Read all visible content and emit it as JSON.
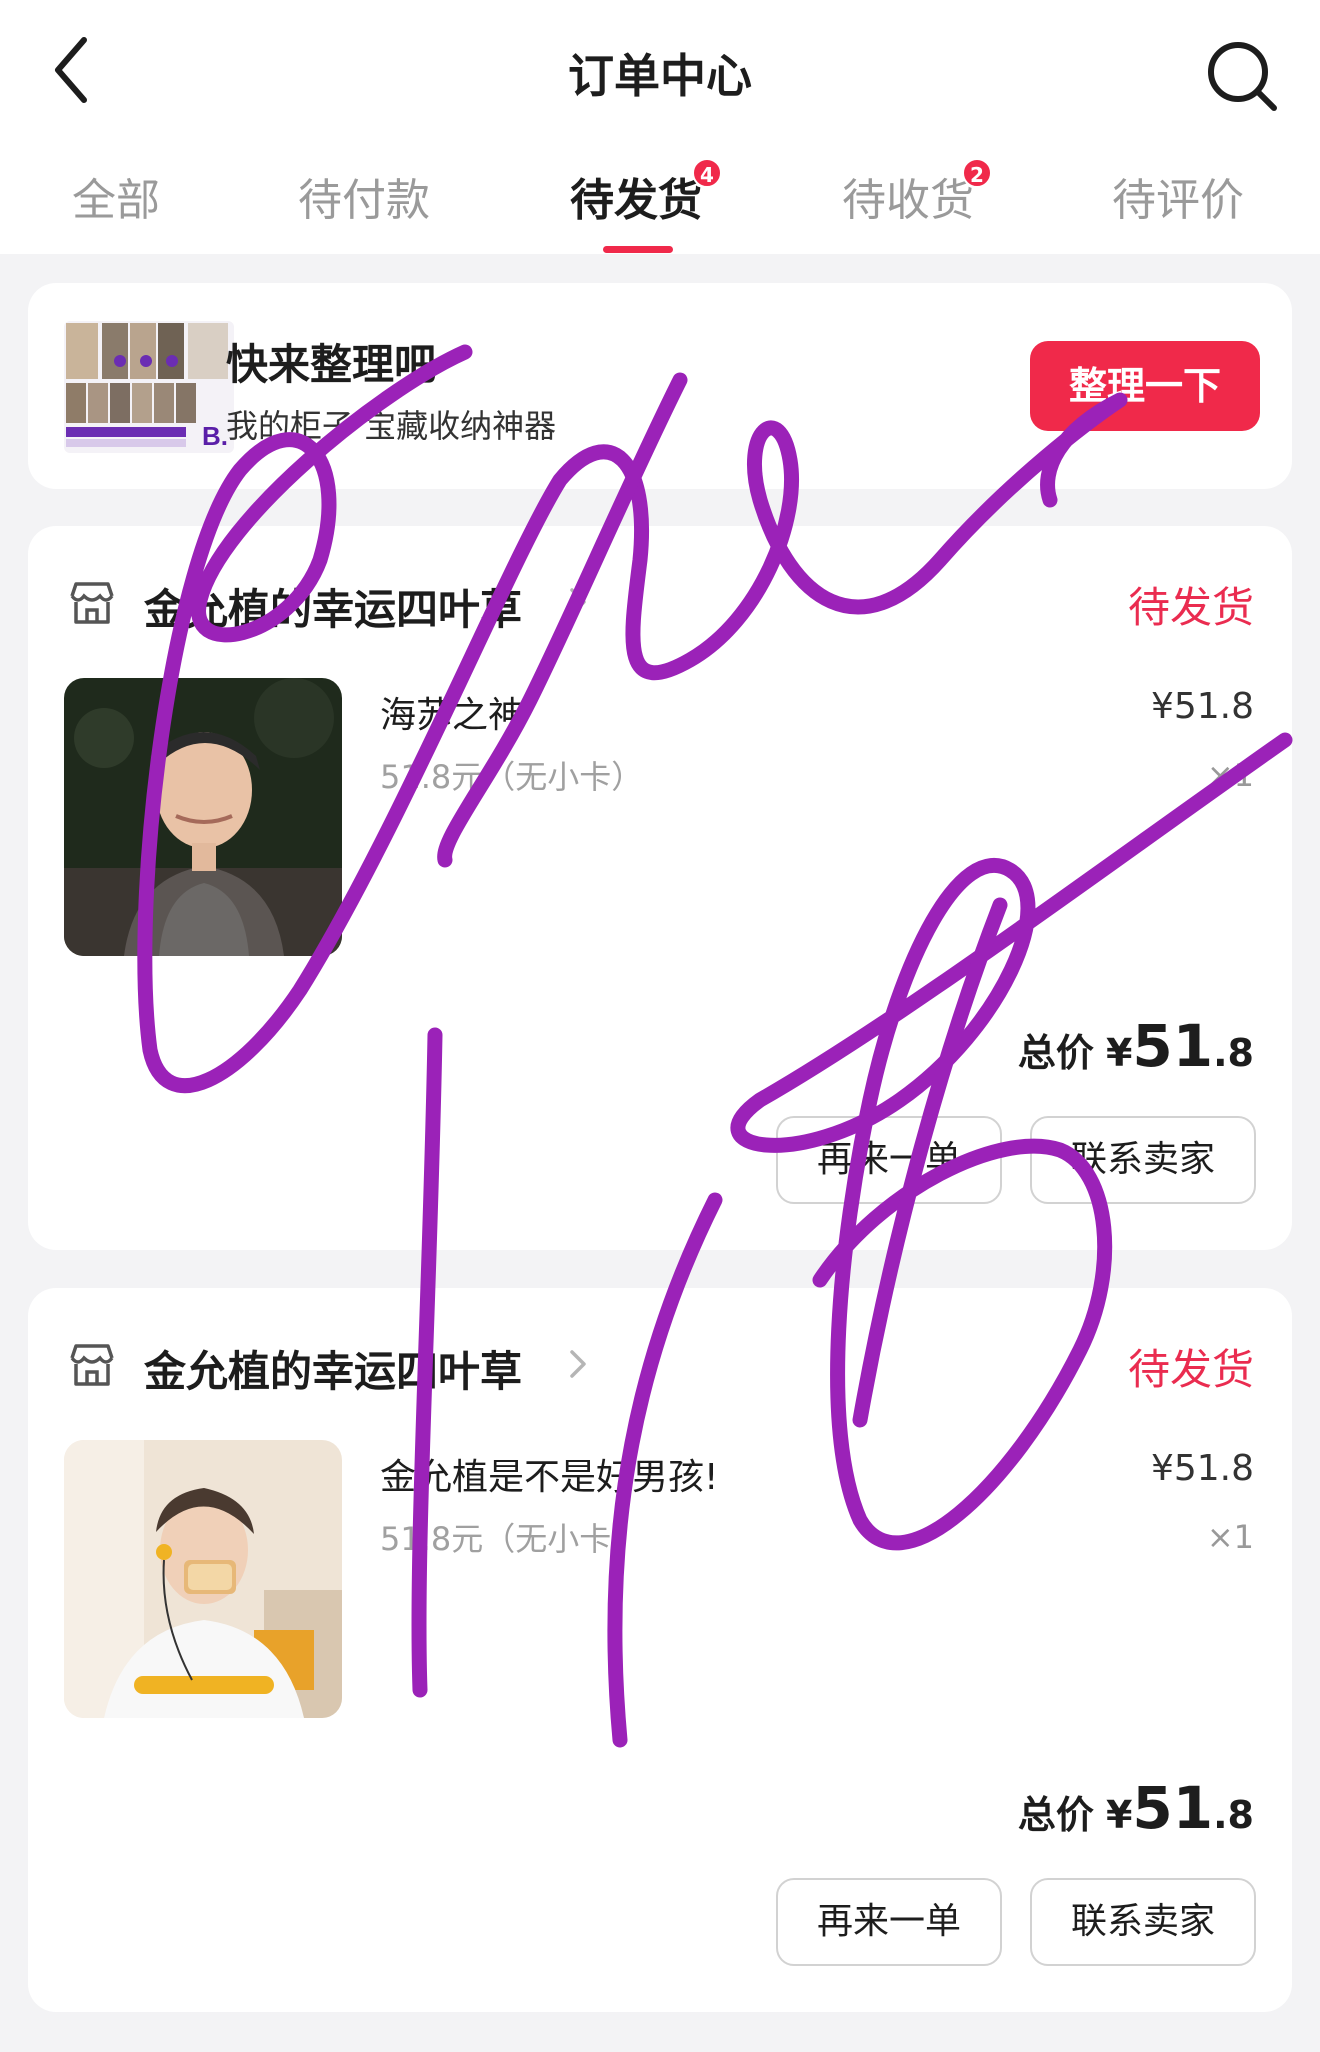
{
  "header": {
    "title": "订单中心",
    "back_icon": "chevron-left-icon",
    "search_icon": "search-icon"
  },
  "tabs": [
    {
      "label": "全部",
      "badge": "",
      "active": false
    },
    {
      "label": "待付款",
      "badge": "",
      "active": false
    },
    {
      "label": "待发货",
      "badge": "4",
      "active": true
    },
    {
      "label": "待收货",
      "badge": "2",
      "active": false
    },
    {
      "label": "待评价",
      "badge": "",
      "active": false
    }
  ],
  "promo": {
    "title": "快来整理吧",
    "subtitle": "我的柜子 宝藏收纳神器",
    "button_label": "整理一下"
  },
  "orders": [
    {
      "shop_name": "金允植的幸运四叶草",
      "status": "待发货",
      "product_name": "海苏之神",
      "product_spec": "51.8元（无小卡）",
      "price": "¥51.8",
      "quantity": "×1",
      "total_label": "总价",
      "total_currency": "¥",
      "total_integer": "51",
      "total_decimal": ".8",
      "reorder_label": "再来一单",
      "contact_label": "联系卖家"
    },
    {
      "shop_name": "金允植的幸运四叶草",
      "status": "待发货",
      "product_name": "金允植是不是好男孩!",
      "product_spec": "51.8元（无小卡）",
      "price": "¥51.8",
      "quantity": "×1",
      "total_label": "总价",
      "total_currency": "¥",
      "total_integer": "51",
      "total_decimal": ".8",
      "reorder_label": "再来一单",
      "contact_label": "联系卖家"
    }
  ],
  "colors": {
    "accent": "#f0294a",
    "status": "#ea2c50",
    "scribble": "#9b22b8"
  }
}
